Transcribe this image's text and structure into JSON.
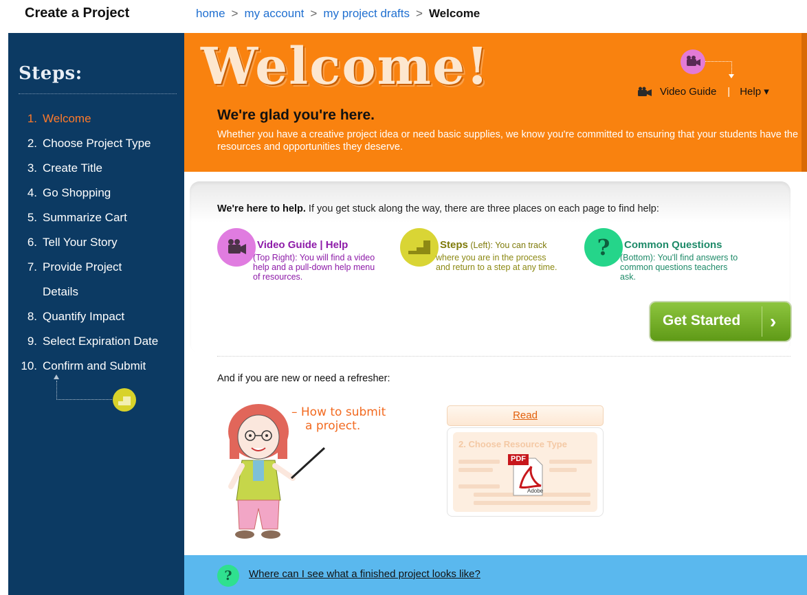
{
  "header": {
    "page_title": "Create a Project",
    "breadcrumb": [
      {
        "label": "home"
      },
      {
        "label": "my account"
      },
      {
        "label": "my project drafts"
      }
    ],
    "breadcrumb_current": "Welcome",
    "breadcrumb_separator": ">"
  },
  "sidebar": {
    "title": "Steps:",
    "steps": [
      {
        "num": "1.",
        "label": "Welcome"
      },
      {
        "num": "2.",
        "label": "Choose Project Type"
      },
      {
        "num": "3.",
        "label": "Create Title"
      },
      {
        "num": "4.",
        "label": "Go Shopping"
      },
      {
        "num": "5.",
        "label": "Summarize Cart"
      },
      {
        "num": "6.",
        "label": "Tell Your Story"
      },
      {
        "num": "7.",
        "label": "Provide Project Details"
      },
      {
        "num": "8.",
        "label": "Quantify Impact"
      },
      {
        "num": "9.",
        "label": "Select Expiration Date"
      },
      {
        "num": "10.",
        "label": "Confirm and Submit"
      }
    ],
    "active_step": 1
  },
  "hero": {
    "title": "Welcome!",
    "heading": "We're glad you're here.",
    "text": "Whether you have a creative project idea or need basic supplies, we know you're committed to ensuring that your students have the resources and opportunities they deserve.",
    "video_guide_label": "Video Guide",
    "separator": "|",
    "help_label": "Help ▾"
  },
  "help": {
    "intro_bold": "We're here to help.",
    "intro_rest": " If you get stuck along the way, there are three places on each page to find help:",
    "columns": [
      {
        "title": "Video Guide | Help",
        "inline": "",
        "desc": "(Top Right): You will find a video help and a pull-down help menu of resources."
      },
      {
        "title": "Steps",
        "inline": " (Left): You can track",
        "desc": "where you are in the process and return to a step at any time."
      },
      {
        "title": "Common Questions",
        "inline": "",
        "desc": "(Bottom): You'll find answers to common questions teachers ask."
      }
    ],
    "get_started_label": "Get Started",
    "get_started_chevron": "›"
  },
  "refresher": {
    "text": "And if you are new or need a refresher:",
    "caption_line1": "– How to submit",
    "caption_line2": "a project.",
    "read_label": "Read",
    "doc_heading": "2. Choose Resource Type",
    "pdf_label": "PDF",
    "adobe_label": "Adobe"
  },
  "footer": {
    "question_mark": "?",
    "link": "Where can I see what a finished project looks like?"
  },
  "colors": {
    "sidebar_bg": "#0c3a63",
    "hero_bg": "#f9820f",
    "active_step": "#ff7a2a",
    "video_purple": "#8d1aa8",
    "steps_olive": "#7e7a09",
    "questions_green": "#1d8a68",
    "button_green": "#6fab22",
    "bottom_bar": "#5ab8ee"
  },
  "icons": [
    "video-camera-icon",
    "steps-stairs-icon",
    "question-icon",
    "chevron-right-icon",
    "pdf-icon",
    "caret-down-icon"
  ]
}
